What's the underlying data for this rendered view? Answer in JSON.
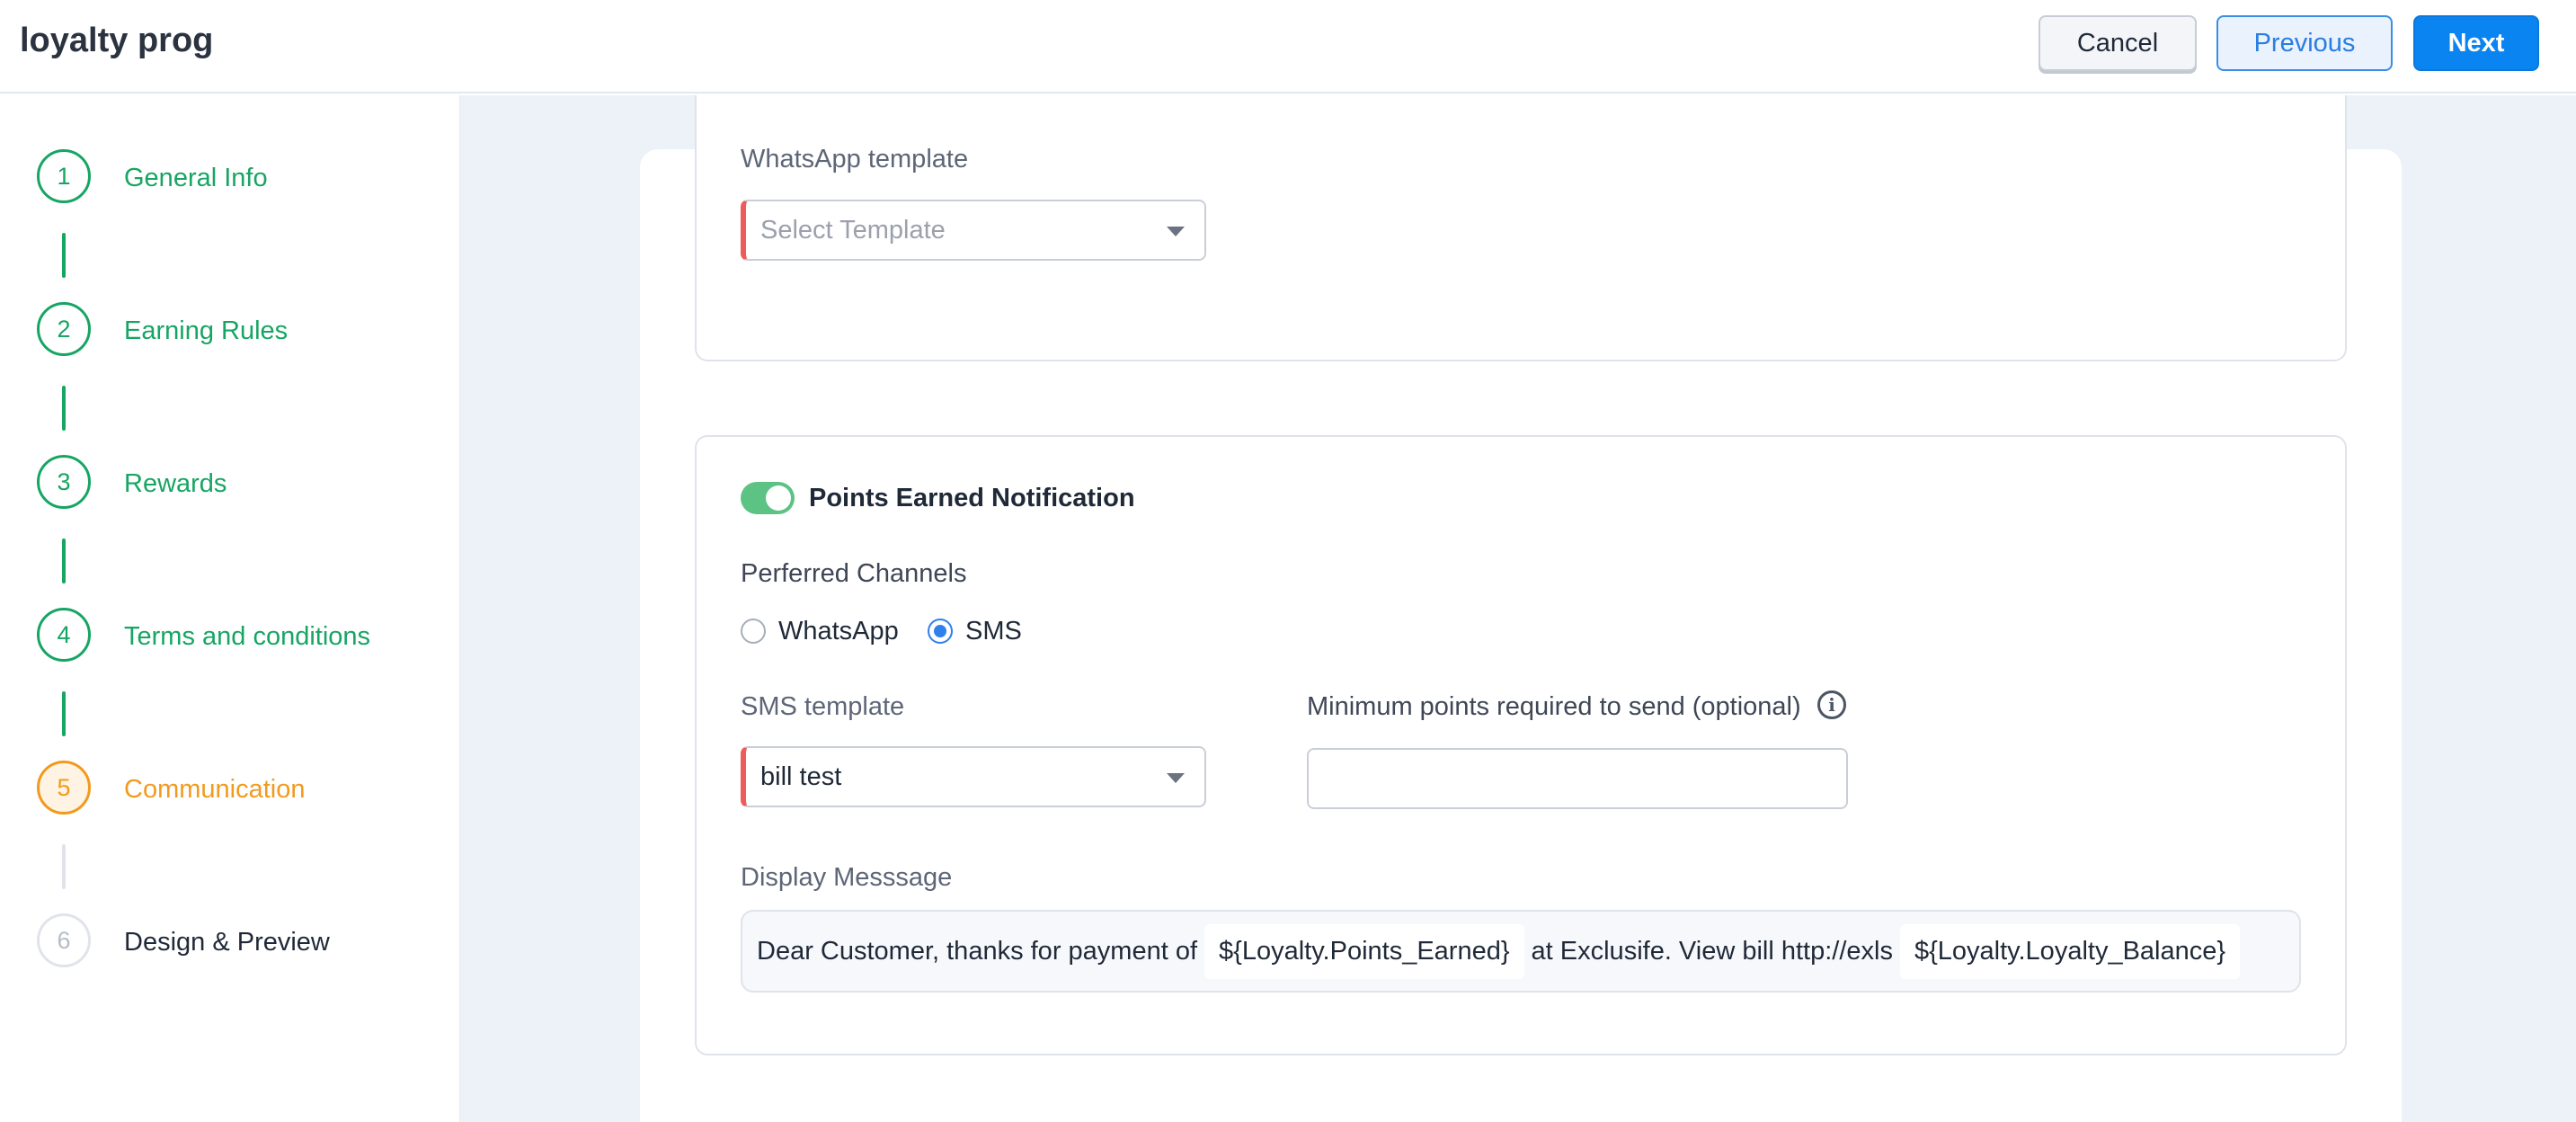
{
  "header": {
    "title": "loyalty prog",
    "cancel_label": "Cancel",
    "previous_label": "Previous",
    "next_label": "Next"
  },
  "steps": [
    {
      "number": "1",
      "label": "General Info",
      "status": "done"
    },
    {
      "number": "2",
      "label": "Earning Rules",
      "status": "done"
    },
    {
      "number": "3",
      "label": "Rewards",
      "status": "done"
    },
    {
      "number": "4",
      "label": "Terms and conditions",
      "status": "done"
    },
    {
      "number": "5",
      "label": "Communication",
      "status": "active"
    },
    {
      "number": "6",
      "label": "Design & Preview",
      "status": "todo"
    }
  ],
  "whatsapp_section": {
    "label": "WhatsApp template",
    "placeholder": "Select Template"
  },
  "points_earned": {
    "toggle_label": "Points Earned Notification",
    "toggle_on": true,
    "channels_label": "Perferred Channels",
    "channels": [
      {
        "label": "WhatsApp",
        "selected": false
      },
      {
        "label": "SMS",
        "selected": true
      }
    ],
    "sms_template_label": "SMS template",
    "sms_template_value": "bill test",
    "min_points_label": "Minimum points required to send (optional)",
    "min_points_value": "",
    "display_message_label": "Display Messsage",
    "message_part1": "Dear Customer, thanks for payment of",
    "message_var1": "${Loyalty.Points_Earned}",
    "message_part2": "at Exclusife. View bill http://exls",
    "message_var2": "${Loyalty.Loyalty_Balance}"
  },
  "colors": {
    "done": "#17a563",
    "active": "#f29a1d",
    "primary": "#0a84f0",
    "required": "#ef5b5b",
    "toggle": "#5cc384"
  }
}
